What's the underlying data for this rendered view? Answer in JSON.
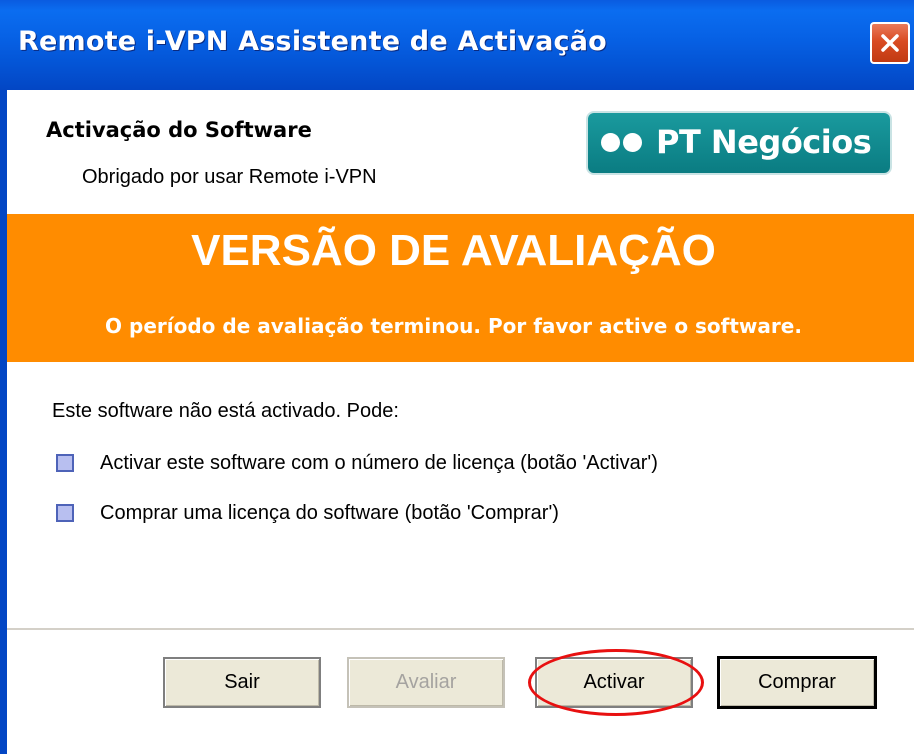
{
  "window": {
    "title": "Remote i-VPN Assistente de Activação"
  },
  "header": {
    "title": "Activação do Software",
    "subtitle": "Obrigado por usar Remote i-VPN",
    "logo_text": "PT Negócios"
  },
  "banner": {
    "title": "VERSÃO DE AVALIAÇÃO",
    "message": "O período de avaliação terminou. Por favor active o software.",
    "color": "#ff8c00"
  },
  "content": {
    "intro": "Este software não está activado. Pode:",
    "options": [
      {
        "label": "Activar este software com o número de licença (botão 'Activar')"
      },
      {
        "label": "Comprar uma licença do software (botão 'Comprar')"
      }
    ]
  },
  "buttons": {
    "sair": "Sair",
    "avaliar": "Avaliar",
    "activar": "Activar",
    "comprar": "Comprar"
  },
  "colors": {
    "titlebar": "#0455d6",
    "highlight": "#e81010"
  }
}
